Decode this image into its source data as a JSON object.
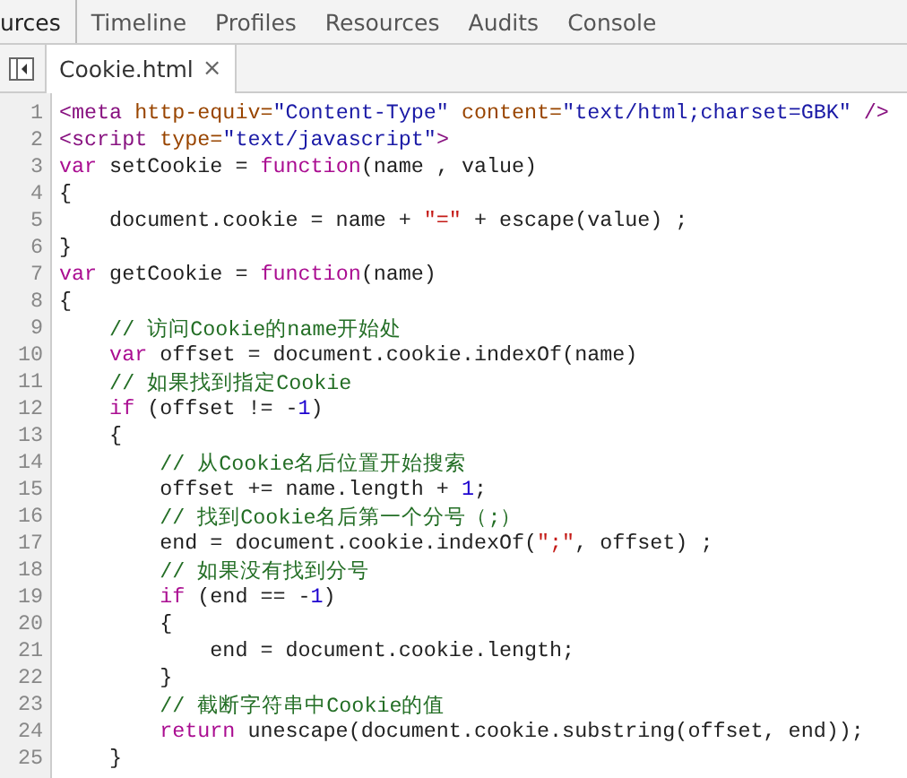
{
  "tabs": [
    {
      "label": "urces",
      "selected": true
    },
    {
      "label": "Timeline",
      "selected": false
    },
    {
      "label": "Profiles",
      "selected": false
    },
    {
      "label": "Resources",
      "selected": false
    },
    {
      "label": "Audits",
      "selected": false
    },
    {
      "label": "Console",
      "selected": false
    }
  ],
  "file_tabs": [
    {
      "label": "Cookie.html",
      "close": "×",
      "selected": true
    }
  ],
  "code": [
    {
      "number": "1",
      "tokens": [
        {
          "kind": "tag",
          "text": "<meta"
        },
        {
          "kind": "attr",
          "text": " http-equiv="
        },
        {
          "kind": "value",
          "text": "\"Content-Type\""
        },
        {
          "kind": "attr",
          "text": " content="
        },
        {
          "kind": "value",
          "text": "\"text/html;charset=GBK\""
        },
        {
          "kind": "tag",
          "text": " />"
        }
      ]
    },
    {
      "number": "2",
      "tokens": [
        {
          "kind": "tag",
          "text": "<script"
        },
        {
          "kind": "attr",
          "text": " type="
        },
        {
          "kind": "value",
          "text": "\"text/javascript\""
        },
        {
          "kind": "tag",
          "text": ">"
        }
      ]
    },
    {
      "number": "3",
      "tokens": [
        {
          "kind": "keyword",
          "text": "var"
        },
        {
          "kind": "plain",
          "text": " setCookie = "
        },
        {
          "kind": "keyword",
          "text": "function"
        },
        {
          "kind": "plain",
          "text": "(name , value)"
        }
      ]
    },
    {
      "number": "4",
      "tokens": [
        {
          "kind": "plain",
          "text": "{"
        }
      ]
    },
    {
      "number": "5",
      "tokens": [
        {
          "kind": "plain",
          "text": "    document.cookie = name + "
        },
        {
          "kind": "string",
          "text": "\"=\""
        },
        {
          "kind": "plain",
          "text": " + escape(value) ;"
        }
      ]
    },
    {
      "number": "6",
      "tokens": [
        {
          "kind": "plain",
          "text": "}"
        }
      ]
    },
    {
      "number": "7",
      "tokens": [
        {
          "kind": "keyword",
          "text": "var"
        },
        {
          "kind": "plain",
          "text": " getCookie = "
        },
        {
          "kind": "keyword",
          "text": "function"
        },
        {
          "kind": "plain",
          "text": "(name)"
        }
      ]
    },
    {
      "number": "8",
      "tokens": [
        {
          "kind": "plain",
          "text": "{"
        }
      ]
    },
    {
      "number": "9",
      "tokens": [
        {
          "kind": "comment",
          "text": "    // 访问Cookie的name开始处"
        }
      ]
    },
    {
      "number": "10",
      "tokens": [
        {
          "kind": "keyword",
          "text": "    var"
        },
        {
          "kind": "plain",
          "text": " offset = document.cookie.indexOf(name)"
        }
      ]
    },
    {
      "number": "11",
      "tokens": [
        {
          "kind": "comment",
          "text": "    // 如果找到指定Cookie"
        }
      ]
    },
    {
      "number": "12",
      "tokens": [
        {
          "kind": "keyword",
          "text": "    if"
        },
        {
          "kind": "plain",
          "text": " (offset != -"
        },
        {
          "kind": "number",
          "text": "1"
        },
        {
          "kind": "plain",
          "text": ")"
        }
      ]
    },
    {
      "number": "13",
      "tokens": [
        {
          "kind": "plain",
          "text": "    {"
        }
      ]
    },
    {
      "number": "14",
      "tokens": [
        {
          "kind": "comment",
          "text": "        // 从Cookie名后位置开始搜索"
        }
      ]
    },
    {
      "number": "15",
      "tokens": [
        {
          "kind": "plain",
          "text": "        offset += name.length + "
        },
        {
          "kind": "number",
          "text": "1"
        },
        {
          "kind": "plain",
          "text": ";"
        }
      ]
    },
    {
      "number": "16",
      "tokens": [
        {
          "kind": "comment",
          "text": "        // 找到Cookie名后第一个分号（;）"
        }
      ]
    },
    {
      "number": "17",
      "tokens": [
        {
          "kind": "plain",
          "text": "        end = document.cookie.indexOf("
        },
        {
          "kind": "string",
          "text": "\";\""
        },
        {
          "kind": "plain",
          "text": ", offset) ;"
        }
      ]
    },
    {
      "number": "18",
      "tokens": [
        {
          "kind": "comment",
          "text": "        // 如果没有找到分号"
        }
      ]
    },
    {
      "number": "19",
      "tokens": [
        {
          "kind": "keyword",
          "text": "        if"
        },
        {
          "kind": "plain",
          "text": " (end == -"
        },
        {
          "kind": "number",
          "text": "1"
        },
        {
          "kind": "plain",
          "text": ")"
        }
      ]
    },
    {
      "number": "20",
      "tokens": [
        {
          "kind": "plain",
          "text": "        {"
        }
      ]
    },
    {
      "number": "21",
      "tokens": [
        {
          "kind": "plain",
          "text": "            end = document.cookie.length;"
        }
      ]
    },
    {
      "number": "22",
      "tokens": [
        {
          "kind": "plain",
          "text": "        }"
        }
      ]
    },
    {
      "number": "23",
      "tokens": [
        {
          "kind": "comment",
          "text": "        // 截断字符串中Cookie的值"
        }
      ]
    },
    {
      "number": "24",
      "tokens": [
        {
          "kind": "keyword",
          "text": "        return"
        },
        {
          "kind": "plain",
          "text": " unescape(document.cookie.substring(offset, end));"
        }
      ]
    },
    {
      "number": "25",
      "tokens": [
        {
          "kind": "plain",
          "text": "    }"
        }
      ]
    }
  ]
}
